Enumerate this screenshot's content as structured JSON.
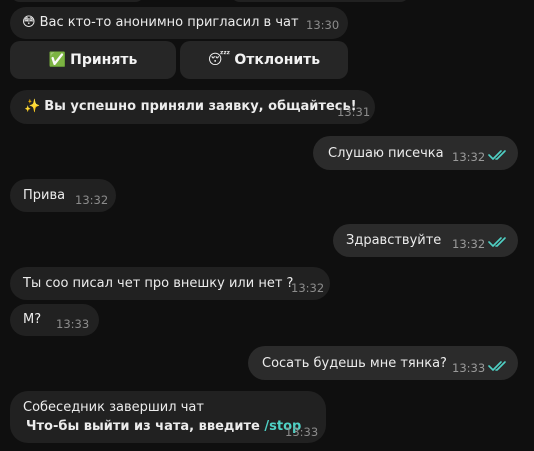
{
  "messages": {
    "invite": {
      "text": "Вас кто-то анонимно пригласил в чат",
      "time": "13:30",
      "emoji": "😳"
    },
    "accept_button": {
      "label": "Принять",
      "emoji": "✅"
    },
    "decline_button": {
      "label": "Отклонить",
      "emoji": "😴"
    },
    "accepted": {
      "text": "Вы успешно приняли заявку, общайтесь!",
      "time": "13:31",
      "emoji": "✨"
    },
    "m1": {
      "text": "Слушаю писечка",
      "time": "13:32"
    },
    "m2": {
      "text": "Прива",
      "time": "13:32"
    },
    "m3": {
      "text": "Здравствуйте",
      "time": "13:32"
    },
    "m4": {
      "text": "Ты соо писал чет про внешку или нет ?",
      "time": "13:32"
    },
    "m5": {
      "text": "М?",
      "time": "13:33"
    },
    "m6": {
      "text": "Сосать будешь мне тянка?",
      "time": "13:33"
    },
    "ended": {
      "line1": "Собеседник завершил чат",
      "line2_prefix": "Что-бы выйти из чата, введите",
      "command": "/stop",
      "time": "13:33"
    }
  },
  "colors": {
    "background": "#0f0f0f",
    "incoming_bubble": "#212121",
    "outgoing_bubble": "#2b2b2b",
    "read_check": "#4fd1c5",
    "command_link": "#4fd1c5"
  },
  "icons": {
    "read_receipt": "double-check-icon"
  }
}
